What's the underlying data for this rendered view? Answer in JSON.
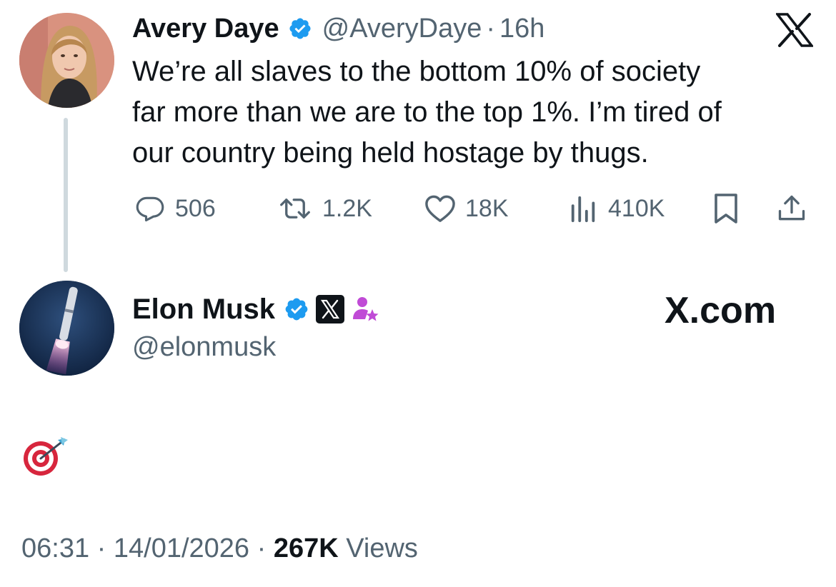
{
  "parent_tweet": {
    "author_name": "Avery Daye",
    "handle": "@AveryDaye",
    "separator": "·",
    "time": "16h",
    "text_lines": [
      "We’re all slaves to the bottom 10% of society",
      "far more than we are to the top 1%. I’m tired of",
      "our country being held hostage by thugs."
    ],
    "actions": {
      "replies": "506",
      "reposts": "1.2K",
      "likes": "18K",
      "views": "410K"
    }
  },
  "reply_tweet": {
    "author_name": "Elon Musk",
    "handle": "@elonmusk",
    "affiliation_label": "X.com",
    "content_emoji": "target-arrow-emoji"
  },
  "meta": {
    "time": "06:31",
    "separator": "·",
    "date": "14/01/2026",
    "views_count": "267K",
    "views_label": "Views"
  },
  "icons": {
    "top_right": "x-logo-icon",
    "verified": "verified-badge-icon",
    "reply": "reply-icon",
    "repost": "repost-icon",
    "like": "heart-icon",
    "views": "views-chart-icon",
    "bookmark": "bookmark-icon",
    "share": "share-icon",
    "x_badge": "x-affiliation-badge-icon",
    "person_badge": "person-star-badge-icon"
  },
  "colors": {
    "text_primary": "#0f1419",
    "text_secondary": "#536471",
    "verified_blue": "#1d9bf0",
    "thread_line": "#cfd9de",
    "badge_purple": "#c04bd6"
  }
}
